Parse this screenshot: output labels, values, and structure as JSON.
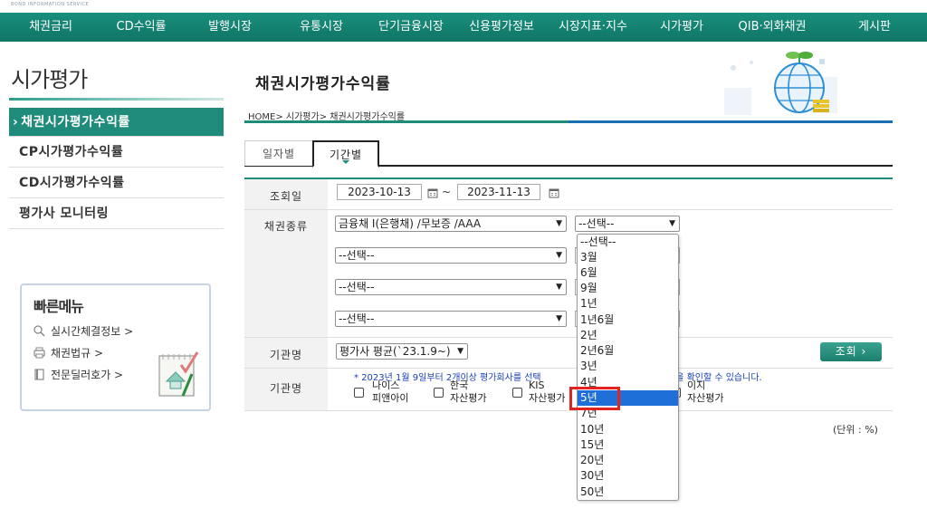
{
  "header": {
    "logo_sub": "BOND INFORMATION SERVICE"
  },
  "nav": [
    "채권금리",
    "CD수익률",
    "발행시장",
    "유통시장",
    "단기금융시장",
    "신용평가정보",
    "시장지표·지수",
    "시가평가",
    "QIB·외화채권",
    "게시판"
  ],
  "sidebar": {
    "title": "시가평가",
    "items": [
      {
        "label": "채권시가평가수익률"
      },
      {
        "label": "CP시가평가수익률"
      },
      {
        "label": "CD시가평가수익률"
      },
      {
        "label": "평가사 모니터링"
      }
    ]
  },
  "quick_menu": {
    "title": "빠른메뉴",
    "links": [
      {
        "label": "실시간체결정보 >",
        "icon": "search-icon"
      },
      {
        "label": "채권법규 >",
        "icon": "printer-icon"
      },
      {
        "label": "전문딜러호가 >",
        "icon": "book-icon"
      }
    ]
  },
  "main": {
    "title": "채권시가평가수익률",
    "breadcrumb": "HOME> 시가평가> 채권시가평가수익률",
    "tabs": [
      "일자별",
      "기간별"
    ],
    "active_tab": "기간별",
    "form": {
      "date_label": "조회일",
      "date_from": "2023-10-13",
      "tilde": "~",
      "date_to": "2023-11-13",
      "bond_type_label": "채권종류",
      "bond_type_value": "금융채 I(은행채) /무보증 /AAA",
      "maturity_value": "--선택--",
      "select_placeholder": "--선택--",
      "agency_label": "기관명",
      "agency_value": "평가사 평균(`23.1.9~)",
      "search_button": "조회 ›",
      "agency_label2": "기관명",
      "notice": "* 2023년 1월 9일부터 2개이상 평가회사를 선택하면 평가사 평균값을 확인할 수 있습니다.",
      "notice_left": "* 2023년 1월 9일부터 2개이상 평가회사를 선택",
      "notice_right": "값을 확인할 수 있습니다.",
      "agencies": [
        {
          "line1": "나이스",
          "line2": "피앤아이"
        },
        {
          "line1": "한국",
          "line2": "자산평가"
        },
        {
          "line1": "KIS",
          "line2": "자산평가"
        },
        {
          "line1": "이지",
          "line2": "자산평가"
        }
      ]
    },
    "unit": "(단위 : %)"
  },
  "dropdown": {
    "options": [
      "--선택--",
      "3월",
      "6월",
      "9월",
      "1년",
      "1년6월",
      "2년",
      "2년6월",
      "3년",
      "4년",
      "5년",
      "7년",
      "10년",
      "15년",
      "20년",
      "30년",
      "50년"
    ],
    "highlighted": "5년"
  },
  "colors": {
    "brand": "#1f8b7a",
    "highlight": "#1e6fd8",
    "annotation": "#e32222",
    "notice": "#1a3fb5"
  }
}
